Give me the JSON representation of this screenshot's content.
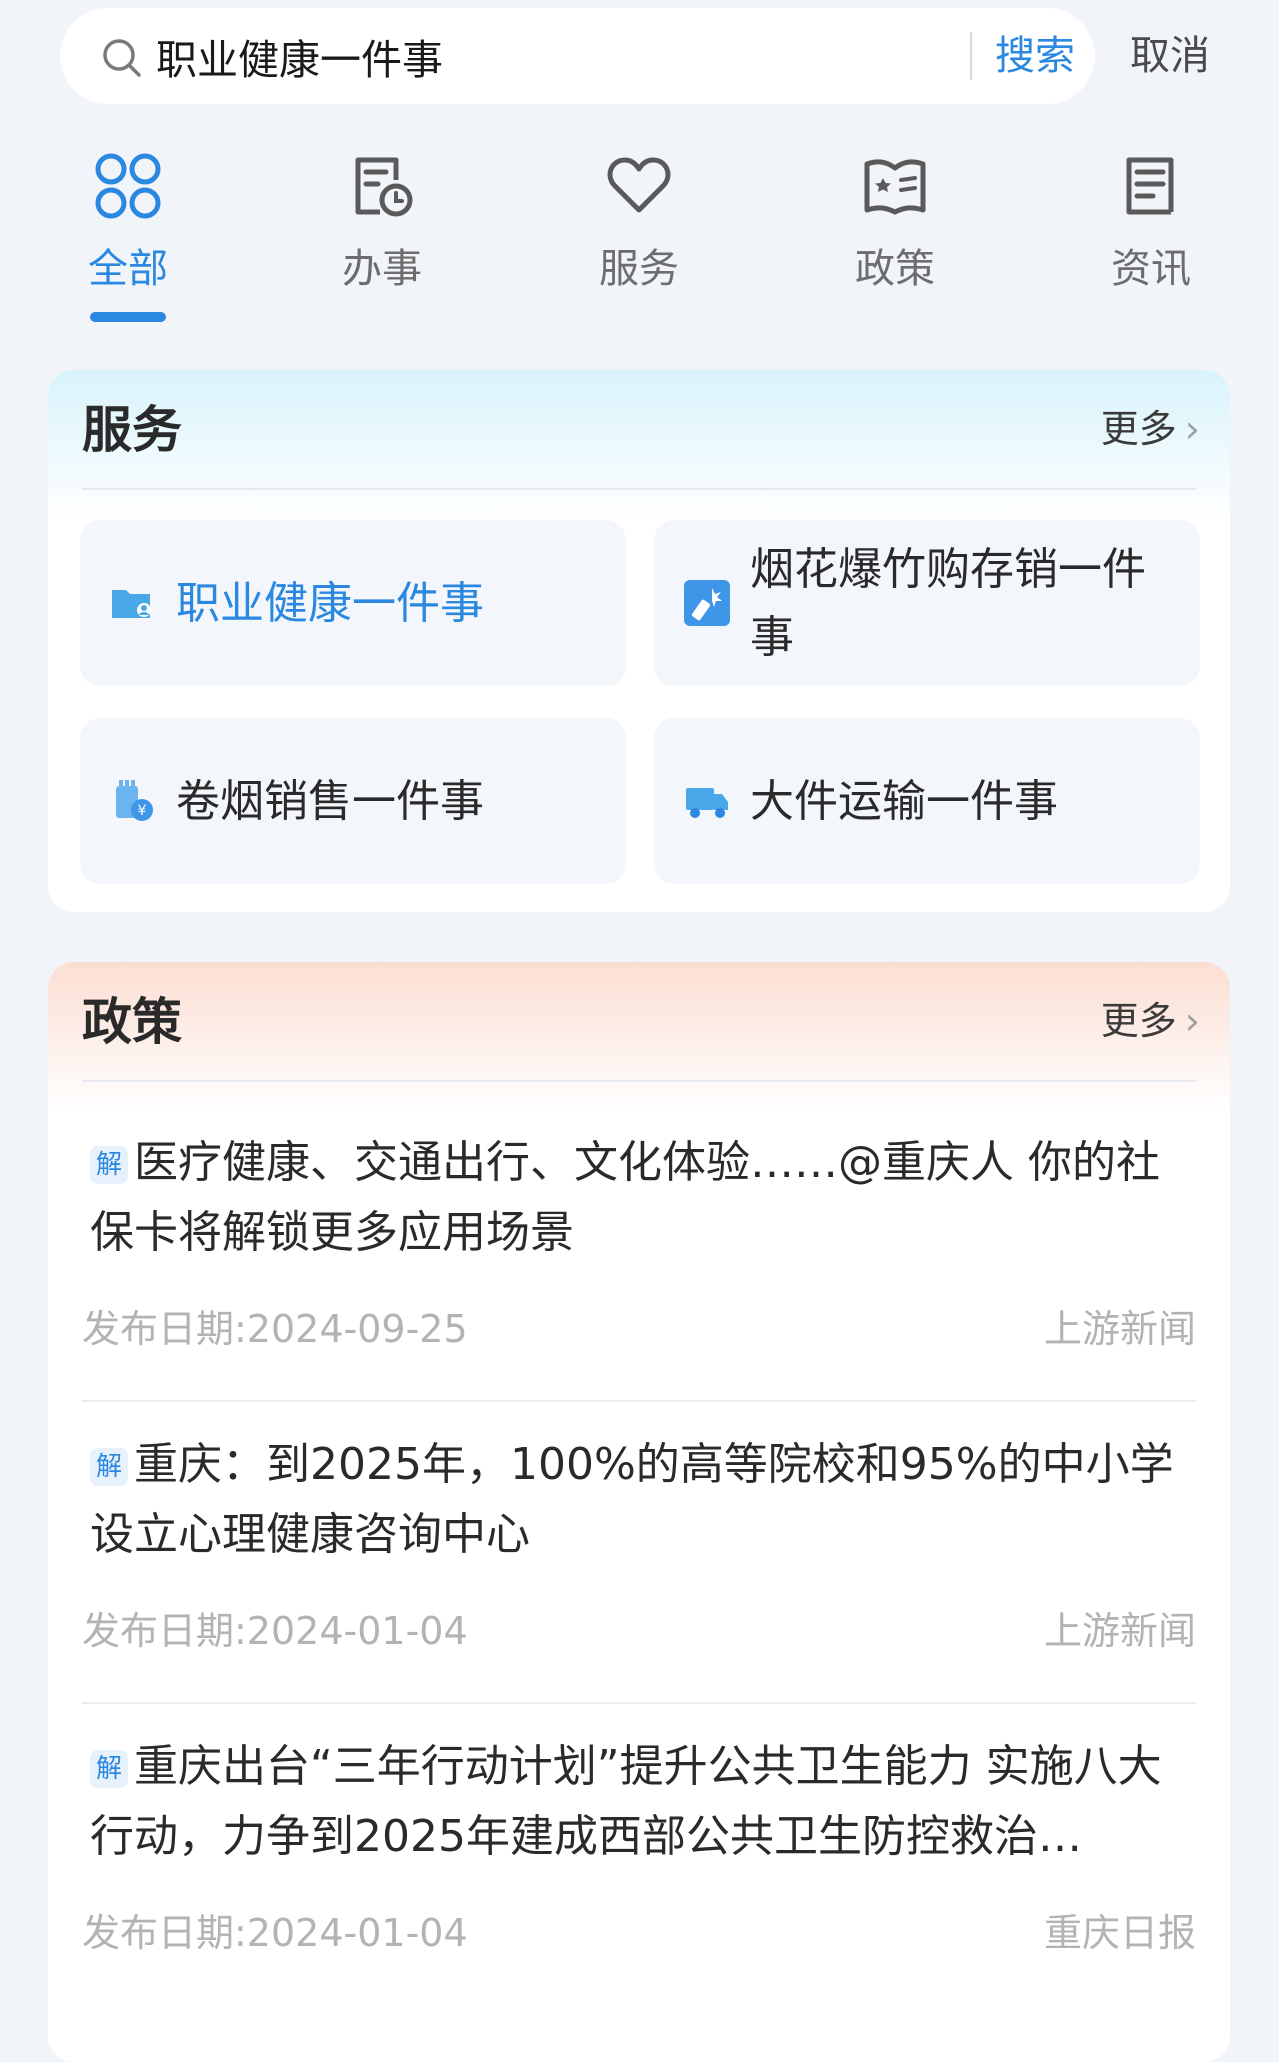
{
  "search": {
    "query": "职业健康一件事",
    "search_label": "搜索",
    "cancel_label": "取消"
  },
  "tabs": [
    {
      "label": "全部",
      "icon": "grid-icon",
      "active": true
    },
    {
      "label": "办事",
      "icon": "document-clock-icon",
      "active": false
    },
    {
      "label": "服务",
      "icon": "heart-icon",
      "active": false
    },
    {
      "label": "政策",
      "icon": "book-star-icon",
      "active": false
    },
    {
      "label": "资讯",
      "icon": "news-icon",
      "active": false
    }
  ],
  "services": {
    "title": "服务",
    "more": "更多",
    "items": [
      {
        "label": "职业健康一件事",
        "icon": "folder-person-icon"
      },
      {
        "label": "烟花爆竹购存销一件事",
        "icon": "firecracker-icon"
      },
      {
        "label": "卷烟销售一件事",
        "icon": "cigarette-yen-icon"
      },
      {
        "label": "大件运输一件事",
        "icon": "truck-icon"
      }
    ]
  },
  "policy": {
    "title": "政策",
    "more": "更多",
    "badge": "解",
    "items": [
      {
        "title": "医疗健康、交通出行、文化体验……@重庆人 你的社保卡将解锁更多应用场景",
        "date": "发布日期:2024-09-25",
        "source": "上游新闻"
      },
      {
        "title": "重庆：到2025年，100%的高等院校和95%的中小学设立心理健康咨询中心",
        "date": "发布日期:2024-01-04",
        "source": "上游新闻"
      },
      {
        "title": "重庆出台“三年行动计划”提升公共卫生能力 实施八大行动，力争到2025年建成西部公共卫生防控救治…",
        "date": "发布日期:2024-01-04",
        "source": "重庆日报"
      }
    ]
  },
  "colors": {
    "accent": "#2b88e0",
    "background": "#f1f5fa",
    "services_header": "#d8f3fb",
    "policy_header": "#fbded2"
  }
}
